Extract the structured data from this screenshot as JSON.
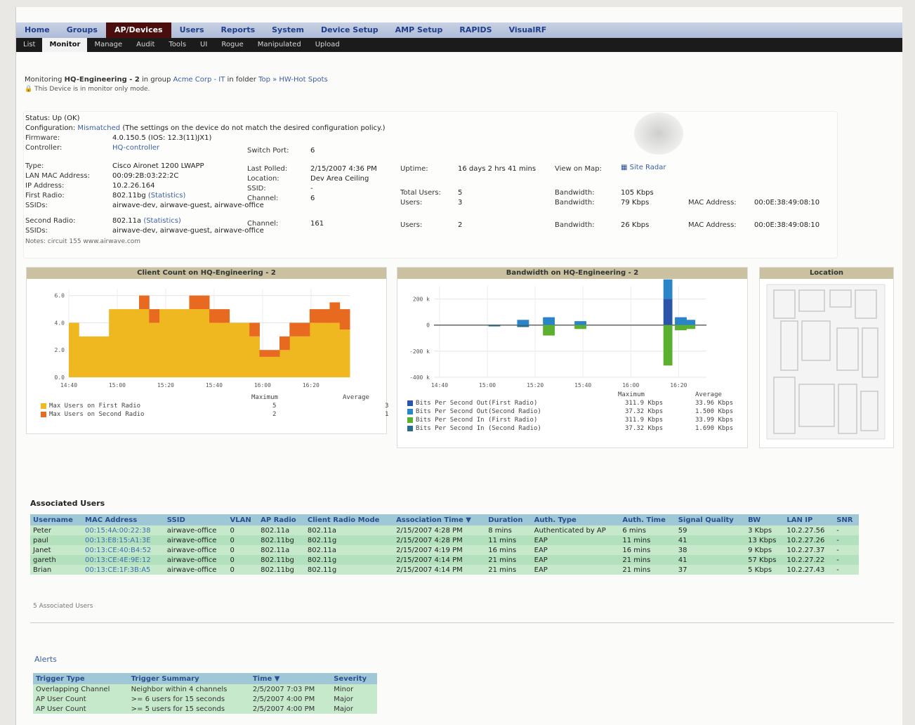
{
  "nav": {
    "top": [
      "Home",
      "Groups",
      "AP/Devices",
      "Users",
      "Reports",
      "System",
      "Device Setup",
      "AMP Setup",
      "RAPIDS",
      "VisualRF"
    ],
    "active_top": 2,
    "sub": [
      "List",
      "Monitor",
      "Manage",
      "Audit",
      "Tools",
      "UI",
      "Rogue",
      "Manipulated",
      "Upload"
    ],
    "active_sub": 1
  },
  "crumbs": {
    "prefix": "Monitoring",
    "device": "HQ-Engineering - 2",
    "in_group": "in group",
    "group": "Acme Corp - IT",
    "in_folder": "in folder",
    "folder": "Top » HW-Hot Spots",
    "monitor_note": "This Device is in monitor only mode."
  },
  "device": {
    "status": "Status: Up (OK)",
    "config_label": "Configuration:",
    "config_value": "Mismatched",
    "config_note": "(The settings on the device do not match the desired configuration policy.)",
    "firmware_label": "Firmware:",
    "firmware_value": "4.0.150.5 (IOS: 12.3(11)JX1)",
    "controller_label": "Controller:",
    "controller_value": "HQ-controller",
    "switchport_label": "Switch Port:",
    "switchport_value": "6",
    "type_label": "Type:",
    "type_value": "Cisco Aironet 1200 LWAPP",
    "lastpolled_label": "Last Polled:",
    "lastpolled_value": "2/15/2007 4:36 PM",
    "uptime_label": "Uptime:",
    "uptime_value": "16 days 2 hrs 41 mins",
    "viewmap_label": "View on Map:",
    "viewmap_value": "Site Radar",
    "lanmac_label": "LAN MAC Address:",
    "lanmac_value": "00:09:2B:03:22:2C",
    "location_label": "Location:",
    "location_value": "Dev Area Ceiling",
    "ip_label": "IP Address:",
    "ip_value": "10.2.26.164",
    "ssid_label": "SSID:",
    "ssid_value": "-",
    "totalusers_label": "Total Users:",
    "totalusers_value": "5",
    "bandwidth_label": "Bandwidth:",
    "bandwidth_total": "105 Kbps",
    "radio1_label": "First Radio:",
    "radio1_value": "802.11bg",
    "radio1_link": "(Statistics)",
    "channel_label": "Channel:",
    "radio1_channel": "6",
    "users_label": "Users:",
    "radio1_users": "3",
    "radio1_bw": "79 Kbps",
    "mac_label": "MAC Address:",
    "radio1_mac": "00:0E:38:49:08:10",
    "ssids_label": "SSIDs:",
    "radio1_ssids": "airwave-dev, airwave-guest, airwave-office",
    "radio2_label": "Second Radio:",
    "radio2_value": "802.11a",
    "radio2_link": "(Statistics)",
    "radio2_channel": "161",
    "radio2_users": "2",
    "radio2_bw": "26 Kbps",
    "radio2_mac": "00:0E:38:49:08:10",
    "radio2_ssids": "airwave-dev, airwave-guest, airwave-office",
    "notes": "Notes: circuit 155 www.airwave.com"
  },
  "panels": {
    "client_title": "Client Count on HQ-Engineering - 2",
    "bw_title": "Bandwidth on HQ-Engineering - 2",
    "loc_title": "Location"
  },
  "client_legend": {
    "maximum_hdr": "Maximum",
    "average_hdr": "Average",
    "rows": [
      {
        "label": "Max Users on First Radio",
        "max": "5",
        "avg": "3",
        "color": "#f0b820"
      },
      {
        "label": "Max Users on Second Radio",
        "max": "2",
        "avg": "1",
        "color": "#e86a20"
      }
    ]
  },
  "bw_legend": {
    "maximum_hdr": "Maximum",
    "average_hdr": "Average",
    "rows": [
      {
        "label": "Bits Per Second Out(First Radio)",
        "max": "311.9 Kbps",
        "avg": "33.96 Kbps",
        "color": "#2a55a8"
      },
      {
        "label": "Bits Per Second Out(Second Radio)",
        "max": "37.32 Kbps",
        "avg": "1.500 Kbps",
        "color": "#2a85c8"
      },
      {
        "label": "Bits Per Second In (First Radio)",
        "max": "311.9 Kbps",
        "avg": "33.99 Kbps",
        "color": "#5cb030"
      },
      {
        "label": "Bits Per Second In (Second Radio)",
        "max": "37.32 Kbps",
        "avg": "1.690 Kbps",
        "color": "#2a6a8a"
      }
    ]
  },
  "chart_data": [
    {
      "type": "area",
      "title": "Client Count on HQ-Engineering - 2",
      "x_ticks": [
        "14:40",
        "15:00",
        "15:20",
        "15:40",
        "16:00",
        "16:20"
      ],
      "y_ticks": [
        "0.0",
        "2.0",
        "4.0",
        "6.0"
      ],
      "ylim": [
        0,
        6.5
      ],
      "series": [
        {
          "name": "Max Users on First Radio",
          "color": "#f0b820",
          "values": [
            4,
            3,
            3,
            3,
            5,
            5,
            5,
            5,
            4,
            5,
            5,
            5,
            5,
            5,
            4,
            4,
            4,
            4,
            3,
            1.5,
            1.5,
            2,
            3,
            3,
            4,
            4,
            4,
            3.5
          ]
        },
        {
          "name": "Max Users on Second Radio",
          "color": "#e86a20",
          "values": [
            0,
            0,
            0,
            0,
            0,
            0,
            0,
            1,
            1,
            0,
            0,
            0,
            1,
            1,
            1,
            1,
            0,
            0,
            1,
            0.5,
            0.5,
            1,
            1,
            1,
            1,
            1,
            1.5,
            1.5
          ]
        }
      ]
    },
    {
      "type": "bar",
      "title": "Bandwidth on HQ-Engineering - 2",
      "x_ticks": [
        "14:40",
        "15:00",
        "15:20",
        "15:40",
        "16:00",
        "16:20"
      ],
      "y_ticks": [
        "200 k",
        "0",
        "-200 k",
        "-400 k"
      ],
      "ylim": [
        -400,
        300
      ],
      "series": [
        {
          "name": "Bits Per Second Out(First Radio)",
          "color": "#2a55a8",
          "values": [
            0,
            0,
            0,
            0,
            0,
            0,
            0,
            0,
            0,
            0,
            0,
            0,
            0,
            0,
            0,
            0,
            0,
            0,
            0,
            0,
            0,
            0,
            0,
            0,
            0,
            0,
            0,
            0,
            0,
            0,
            0,
            0,
            0,
            0,
            0,
            0,
            0,
            0,
            0,
            0,
            0,
            0,
            0,
            0,
            0,
            0,
            0,
            0,
            0,
            0,
            0,
            0,
            0,
            0,
            0,
            0,
            0,
            0,
            0,
            0,
            0,
            0,
            0,
            0,
            0,
            0,
            0,
            0,
            0,
            0,
            0,
            0,
            0,
            0,
            0,
            0,
            0,
            0,
            0,
            0,
            200,
            200,
            200,
            0,
            0,
            0,
            0,
            0,
            0,
            0,
            0,
            0,
            0,
            0,
            0
          ]
        },
        {
          "name": "Bits Per Second Out(Second Radio)",
          "color": "#2a85c8",
          "values": [
            0,
            0,
            0,
            0,
            0,
            0,
            0,
            0,
            0,
            0,
            0,
            0,
            0,
            0,
            0,
            0,
            0,
            0,
            0,
            0,
            0,
            0,
            0,
            0,
            0,
            0,
            0,
            0,
            0,
            40,
            40,
            40,
            40,
            0,
            0,
            0,
            0,
            0,
            60,
            60,
            60,
            60,
            0,
            0,
            0,
            0,
            0,
            0,
            0,
            30,
            30,
            30,
            30,
            0,
            0,
            0,
            0,
            0,
            0,
            0,
            0,
            0,
            0,
            0,
            0,
            0,
            0,
            0,
            0,
            0,
            0,
            0,
            0,
            0,
            0,
            0,
            0,
            0,
            0,
            0,
            150,
            150,
            150,
            0,
            60,
            60,
            60,
            60,
            40,
            40,
            40,
            0,
            0,
            0,
            0
          ]
        },
        {
          "name": "Bits Per Second In (First Radio)",
          "color": "#5cb030",
          "values": [
            0,
            0,
            0,
            0,
            0,
            0,
            0,
            0,
            0,
            0,
            0,
            0,
            0,
            0,
            0,
            0,
            0,
            0,
            0,
            0,
            0,
            0,
            0,
            0,
            0,
            0,
            0,
            0,
            0,
            0,
            0,
            0,
            0,
            0,
            0,
            0,
            0,
            0,
            -80,
            -80,
            -80,
            -80,
            0,
            0,
            0,
            0,
            0,
            0,
            0,
            -30,
            -30,
            -30,
            -30,
            0,
            0,
            0,
            0,
            0,
            0,
            0,
            0,
            0,
            0,
            0,
            0,
            0,
            0,
            0,
            0,
            0,
            0,
            0,
            0,
            0,
            0,
            0,
            0,
            0,
            0,
            0,
            -310,
            -310,
            -310,
            0,
            -40,
            -40,
            -40,
            -40,
            -30,
            -30,
            -30,
            0,
            0,
            0,
            0
          ]
        },
        {
          "name": "Bits Per Second In (Second Radio)",
          "color": "#2a6a8a",
          "values": [
            0,
            0,
            0,
            0,
            0,
            0,
            0,
            0,
            0,
            0,
            0,
            0,
            0,
            0,
            0,
            0,
            0,
            0,
            0,
            -10,
            -10,
            -10,
            -10,
            0,
            0,
            0,
            0,
            0,
            0,
            -15,
            -15,
            -15,
            -15,
            0,
            0,
            0,
            0,
            0,
            0,
            0,
            0,
            0,
            0,
            0,
            0,
            0,
            0,
            0,
            0,
            0,
            0,
            0,
            0,
            0,
            0,
            0,
            0,
            0,
            0,
            0,
            0,
            0,
            0,
            0,
            0,
            0,
            0,
            0,
            0,
            0,
            0,
            0,
            0,
            0,
            0,
            0,
            0,
            0,
            0,
            0,
            0,
            0,
            0,
            0,
            0,
            0,
            0,
            0,
            0,
            0,
            0,
            0,
            0,
            0,
            0
          ]
        }
      ]
    }
  ],
  "users_section": {
    "title": "Associated Users",
    "count_note": "5 Associated Users",
    "columns": [
      "Username",
      "MAC Address",
      "SSID",
      "VLAN",
      "AP Radio",
      "Client Radio Mode",
      "Association Time ▼",
      "Duration",
      "Auth. Type",
      "Auth. Time",
      "Signal Quality",
      "BW",
      "LAN IP",
      "SNR"
    ],
    "rows": [
      [
        "Peter",
        "00:15:4A:00:22:38",
        "airwave-office",
        "0",
        "802.11a",
        "802.11a",
        "2/15/2007 4:28 PM",
        "8 mins",
        "Authenticated by AP",
        "6 mins",
        "59",
        "3 Kbps",
        "10.2.27.56",
        "-"
      ],
      [
        "paul",
        "00:13:E8:15:A1:3E",
        "airwave-office",
        "0",
        "802.11bg",
        "802.11g",
        "2/15/2007 4:28 PM",
        "11 mins",
        "EAP",
        "11 mins",
        "41",
        "13 Kbps",
        "10.2.27.26",
        "-"
      ],
      [
        "Janet",
        "00:13:CE:40:B4:52",
        "airwave-office",
        "0",
        "802.11a",
        "802.11a",
        "2/15/2007 4:19 PM",
        "16 mins",
        "EAP",
        "16 mins",
        "38",
        "9 Kbps",
        "10.2.27.37",
        "-"
      ],
      [
        "gareth",
        "00:13:CE:4E:9E:12",
        "airwave-office",
        "0",
        "802.11bg",
        "802.11g",
        "2/15/2007 4:14 PM",
        "21 mins",
        "EAP",
        "21 mins",
        "41",
        "57 Kbps",
        "10.2.27.22",
        "-"
      ],
      [
        "Brian",
        "00:13:CE:1F:3B:A5",
        "airwave-office",
        "0",
        "802.11bg",
        "802.11g",
        "2/15/2007 4:14 PM",
        "21 mins",
        "EAP",
        "21 mins",
        "37",
        "5 Kbps",
        "10.2.27.43",
        "-"
      ]
    ]
  },
  "alerts_section": {
    "title": "Alerts",
    "columns": [
      "Trigger Type",
      "Trigger Summary",
      "Time ▼",
      "Severity"
    ],
    "rows": [
      [
        "Overlapping Channel",
        "Neighbor within 4 channels",
        "2/5/2007 7:03 PM",
        "Minor"
      ],
      [
        "AP User Count",
        ">= 6 users for 15 seconds",
        "2/5/2007 4:00 PM",
        "Major"
      ],
      [
        "AP User Count",
        ">= 5 users for 15 seconds",
        "2/5/2007 4:00 PM",
        "Major"
      ]
    ]
  }
}
